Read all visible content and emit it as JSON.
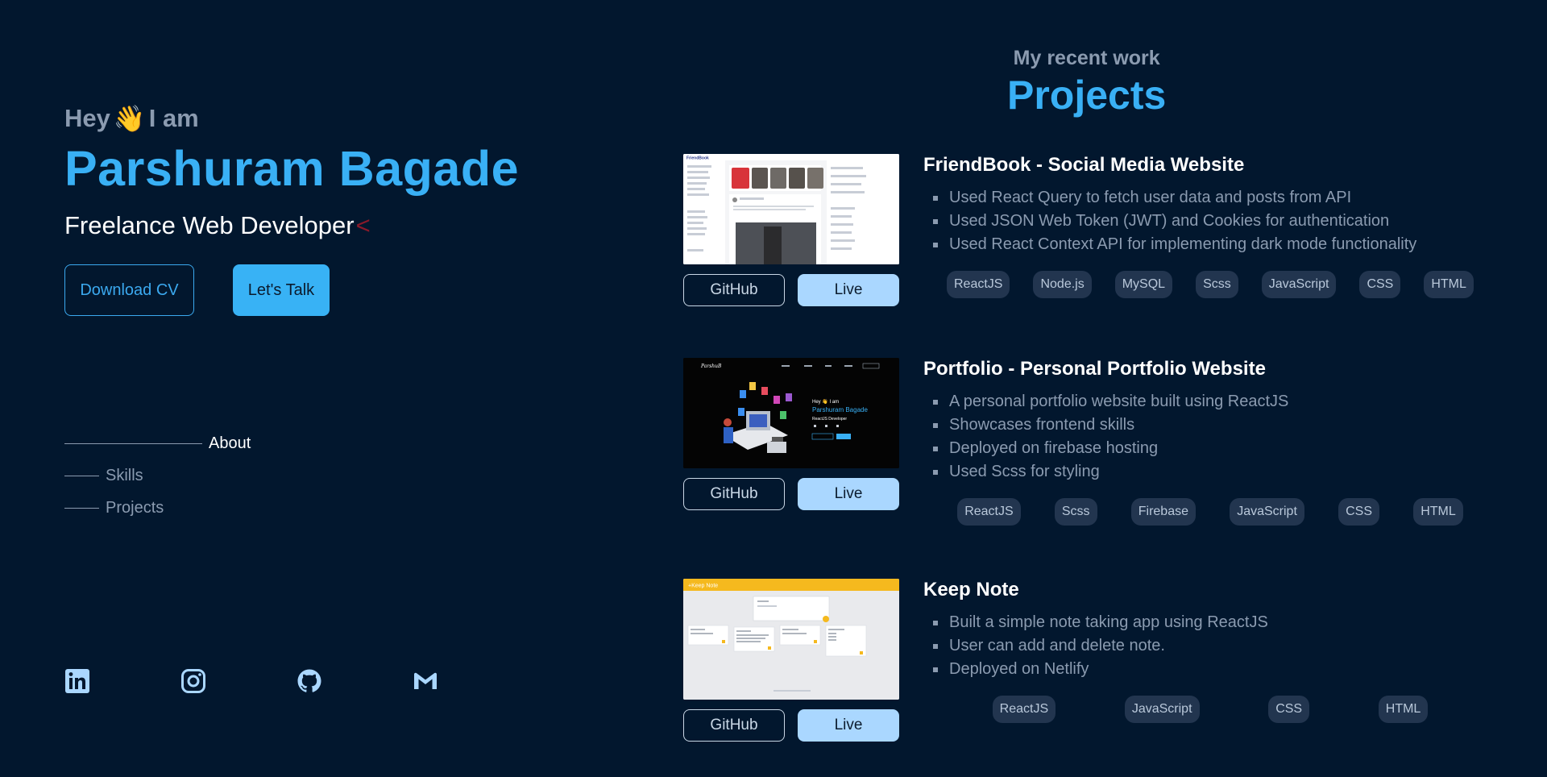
{
  "hero": {
    "greeting": "Hey",
    "greeting_emoji": "👋",
    "greeting_suffix": "I am",
    "name": "Parshuram Bagade",
    "role": "Freelance Web Developer",
    "cursor": "<",
    "download_cv_label": "Download CV",
    "lets_talk_label": "Let's Talk"
  },
  "nav": {
    "items": [
      {
        "label": "About",
        "active": true
      },
      {
        "label": "Skills",
        "active": false
      },
      {
        "label": "Projects",
        "active": false
      }
    ]
  },
  "socials": [
    {
      "icon": "linkedin-icon"
    },
    {
      "icon": "instagram-icon"
    },
    {
      "icon": "github-icon"
    },
    {
      "icon": "gmail-icon"
    }
  ],
  "projects_section": {
    "subtitle": "My recent work",
    "title": "Projects",
    "github_label": "GitHub",
    "live_label": "Live"
  },
  "projects": [
    {
      "title": "FriendBook - Social Media Website",
      "points": [
        "Used React Query to fetch user data and posts from API",
        "Used JSON Web Token (JWT) and Cookies for authentication",
        "Used React Context API for implementing dark mode functionality"
      ],
      "tags": [
        "ReactJS",
        "Node.js",
        "MySQL",
        "Scss",
        "JavaScript",
        "CSS",
        "HTML"
      ]
    },
    {
      "title": "Portfolio - Personal Portfolio Website",
      "points": [
        "A personal portfolio website built using ReactJS",
        "Showcases frontend skills",
        "Deployed on firebase hosting",
        "Used Scss for styling"
      ],
      "tags": [
        "ReactJS",
        "Scss",
        "Firebase",
        "JavaScript",
        "CSS",
        "HTML"
      ]
    },
    {
      "title": "Keep Note",
      "points": [
        "Built a simple note taking app using ReactJS",
        "User can add and delete note.",
        "Deployed on Netlify"
      ],
      "tags": [
        "ReactJS",
        "JavaScript",
        "CSS",
        "HTML"
      ]
    }
  ],
  "thumbnails": {
    "friendbook_logo": "FriendBook",
    "portfolio_greeting": "Hey 👋 I am",
    "portfolio_name": "Parshuram Bagade",
    "portfolio_role": "ReactJS Developer",
    "keepnote_logo": "+Keep Note"
  },
  "colors": {
    "background": "#02172e",
    "accent": "#39b0f5",
    "muted": "#8b9bb0",
    "live_button": "#aad7ff",
    "tag_bg": "#22354f"
  }
}
